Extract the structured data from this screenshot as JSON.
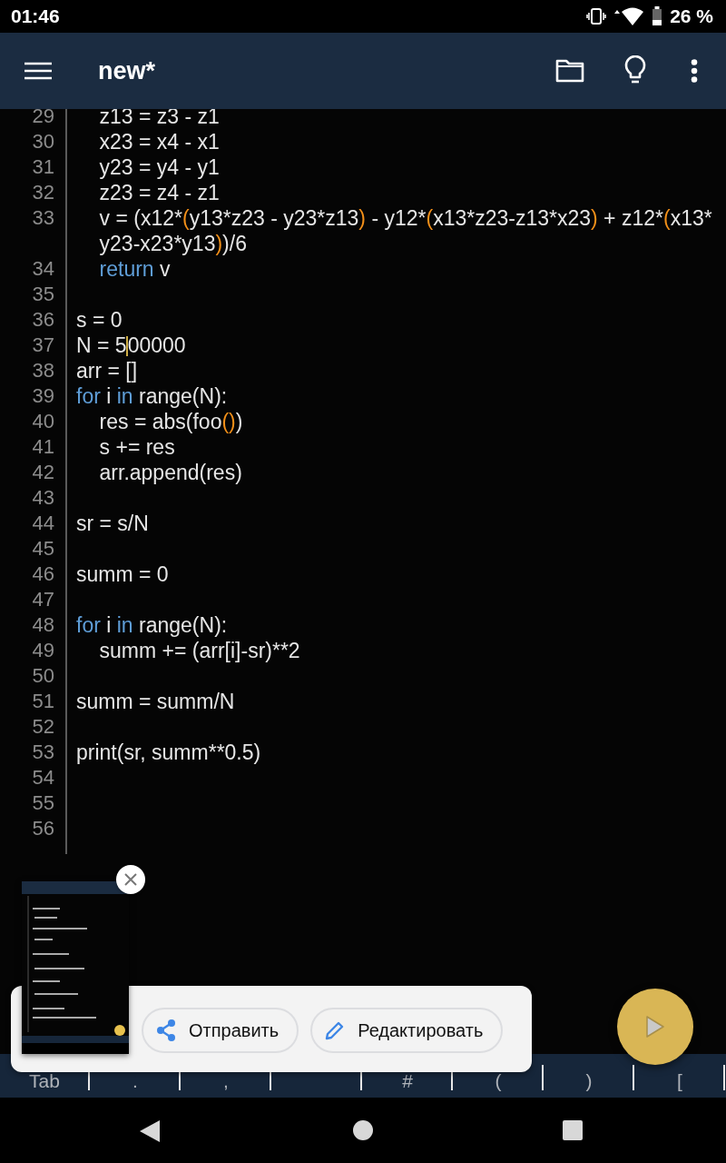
{
  "status_bar": {
    "time": "01:46",
    "battery": "26 %"
  },
  "app_bar": {
    "title": "new*"
  },
  "editor": {
    "lines": [
      {
        "number": "29",
        "tokens": [
          {
            "kind": "plain",
            "text": "    z13 = z3 - z1"
          }
        ]
      },
      {
        "number": "30",
        "tokens": [
          {
            "kind": "plain",
            "text": "    x23 = x4 - x1"
          }
        ]
      },
      {
        "number": "31",
        "tokens": [
          {
            "kind": "plain",
            "text": "    y23 = y4 - y1"
          }
        ]
      },
      {
        "number": "32",
        "tokens": [
          {
            "kind": "plain",
            "text": "    z23 = z4 - z1"
          }
        ]
      },
      {
        "number": "33",
        "tokens": [
          {
            "kind": "plain",
            "text": "    v = (x12*"
          },
          {
            "kind": "bracket",
            "text": "("
          },
          {
            "kind": "plain",
            "text": "y13*z23 - y23*z13"
          },
          {
            "kind": "bracket",
            "text": ")"
          },
          {
            "kind": "plain",
            "text": " - y12*"
          },
          {
            "kind": "bracket",
            "text": "("
          },
          {
            "kind": "plain",
            "text": "x13*z23-z13*x23"
          },
          {
            "kind": "bracket",
            "text": ")"
          },
          {
            "kind": "plain",
            "text": " + z12*"
          },
          {
            "kind": "bracket",
            "text": "("
          },
          {
            "kind": "plain",
            "text": "x13*"
          }
        ],
        "continuation": [
          {
            "kind": "plain",
            "text": "    y23-x23*y13"
          },
          {
            "kind": "bracket",
            "text": ")"
          },
          {
            "kind": "plain",
            "text": ")/6"
          }
        ]
      },
      {
        "number": "34",
        "tokens": [
          {
            "kind": "keyword",
            "text": "    return"
          },
          {
            "kind": "plain",
            "text": " v"
          }
        ]
      },
      {
        "number": "35"
      },
      {
        "number": "36",
        "tokens": [
          {
            "kind": "plain",
            "text": "s = 0"
          }
        ]
      },
      {
        "number": "37",
        "tokens": [
          {
            "kind": "plain",
            "text": "N = 5"
          },
          {
            "kind": "cursor"
          },
          {
            "kind": "plain",
            "text": "00000"
          }
        ]
      },
      {
        "number": "38",
        "tokens": [
          {
            "kind": "plain",
            "text": "arr = []"
          }
        ]
      },
      {
        "number": "39",
        "tokens": [
          {
            "kind": "keyword",
            "text": "for"
          },
          {
            "kind": "plain",
            "text": " i "
          },
          {
            "kind": "keyword",
            "text": "in"
          },
          {
            "kind": "plain",
            "text": " range(N):"
          }
        ]
      },
      {
        "number": "40",
        "tokens": [
          {
            "kind": "plain",
            "text": "    res = abs(foo"
          },
          {
            "kind": "bracket",
            "text": "()"
          },
          {
            "kind": "plain",
            "text": ")"
          }
        ]
      },
      {
        "number": "41",
        "tokens": [
          {
            "kind": "plain",
            "text": "    s += res"
          }
        ]
      },
      {
        "number": "42",
        "tokens": [
          {
            "kind": "plain",
            "text": "    arr.append(res)"
          }
        ]
      },
      {
        "number": "43"
      },
      {
        "number": "44",
        "tokens": [
          {
            "kind": "plain",
            "text": "sr = s/N"
          }
        ]
      },
      {
        "number": "45"
      },
      {
        "number": "46",
        "tokens": [
          {
            "kind": "plain",
            "text": "summ = 0"
          }
        ]
      },
      {
        "number": "47"
      },
      {
        "number": "48",
        "tokens": [
          {
            "kind": "keyword",
            "text": "for"
          },
          {
            "kind": "plain",
            "text": " i "
          },
          {
            "kind": "keyword",
            "text": "in"
          },
          {
            "kind": "plain",
            "text": " range(N):"
          }
        ]
      },
      {
        "number": "49",
        "tokens": [
          {
            "kind": "plain",
            "text": "    summ += (arr[i]-sr)**2"
          }
        ]
      },
      {
        "number": "50"
      },
      {
        "number": "51",
        "tokens": [
          {
            "kind": "plain",
            "text": "summ = summ/N"
          }
        ]
      },
      {
        "number": "52"
      },
      {
        "number": "53",
        "tokens": [
          {
            "kind": "plain",
            "text": "print(sr, summ**0.5)"
          }
        ]
      },
      {
        "number": "54"
      },
      {
        "number": "55"
      },
      {
        "number": "56"
      }
    ]
  },
  "key_bar": {
    "keys": [
      {
        "kind": "label",
        "label": "Tab"
      },
      {
        "kind": "label",
        "label": "."
      },
      {
        "kind": "label",
        "label": ","
      },
      {
        "kind": "space"
      },
      {
        "kind": "label",
        "label": "#"
      },
      {
        "kind": "label",
        "label": "("
      },
      {
        "kind": "label",
        "label": ")"
      },
      {
        "kind": "label",
        "label": "["
      }
    ]
  },
  "screenshot_popup": {
    "actions": [
      {
        "kind": "share",
        "label": "Отправить"
      },
      {
        "kind": "edit",
        "label": "Редактировать"
      }
    ]
  }
}
